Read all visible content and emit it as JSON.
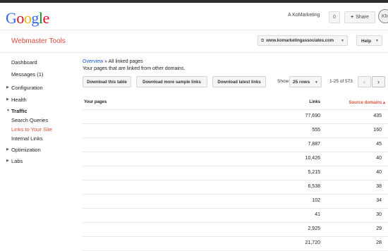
{
  "gbar": {
    "logo_letters": [
      {
        "char": "G",
        "color": "#3369e8"
      },
      {
        "char": "o",
        "color": "#d50f25"
      },
      {
        "char": "o",
        "color": "#eeb211"
      },
      {
        "char": "g",
        "color": "#3369e8"
      },
      {
        "char": "l",
        "color": "#009925"
      },
      {
        "char": "e",
        "color": "#d50f25"
      }
    ],
    "user_name": "A KoMarketing",
    "notification_count": "0",
    "share_label": "Share",
    "avatar_initials": "KM"
  },
  "app_header": {
    "title": "Webmaster Tools",
    "site": "www.komarketingassociates.com",
    "help_label": "Help"
  },
  "sidebar": {
    "items": [
      {
        "label": "Dashboard"
      },
      {
        "label": "Messages (1)"
      },
      {
        "label": "Configuration"
      },
      {
        "label": "Health"
      },
      {
        "label": "Traffic"
      },
      {
        "label": "Search Queries"
      },
      {
        "label": "Links to Your Site"
      },
      {
        "label": "Internal Links"
      },
      {
        "label": "Optimization"
      },
      {
        "label": "Labs"
      }
    ]
  },
  "main": {
    "breadcrumb_link": "Overview",
    "breadcrumb_separator": "»",
    "breadcrumb_current": "All linked pages",
    "subtitle": "Your pages that are linked from other domains.",
    "buttons": {
      "download_table": "Download this table",
      "download_more": "Download more sample links",
      "download_latest": "Download latest links"
    },
    "show_label": "Show",
    "rows_option": "25 rows",
    "range_text": "1-25 of 573",
    "columns": {
      "pages": "Your pages",
      "links": "Links",
      "domains": "Source domains ▴"
    },
    "rows": [
      {
        "page": "",
        "links": "77,690",
        "domains": "435"
      },
      {
        "page": "",
        "links": "555",
        "domains": "160"
      },
      {
        "page": "",
        "links": "7,887",
        "domains": "45"
      },
      {
        "page": "",
        "links": "10,426",
        "domains": "40"
      },
      {
        "page": "",
        "links": "5,215",
        "domains": "40"
      },
      {
        "page": "",
        "links": "6,538",
        "domains": "38"
      },
      {
        "page": "",
        "links": "102",
        "domains": "34"
      },
      {
        "page": "",
        "links": "41",
        "domains": "30"
      },
      {
        "page": "",
        "links": "2,925",
        "domains": "29"
      },
      {
        "page": "",
        "links": "21,720",
        "domains": "28"
      }
    ]
  },
  "colors": {
    "accent_red": "#dd4b39",
    "link_blue": "#1155cc"
  }
}
